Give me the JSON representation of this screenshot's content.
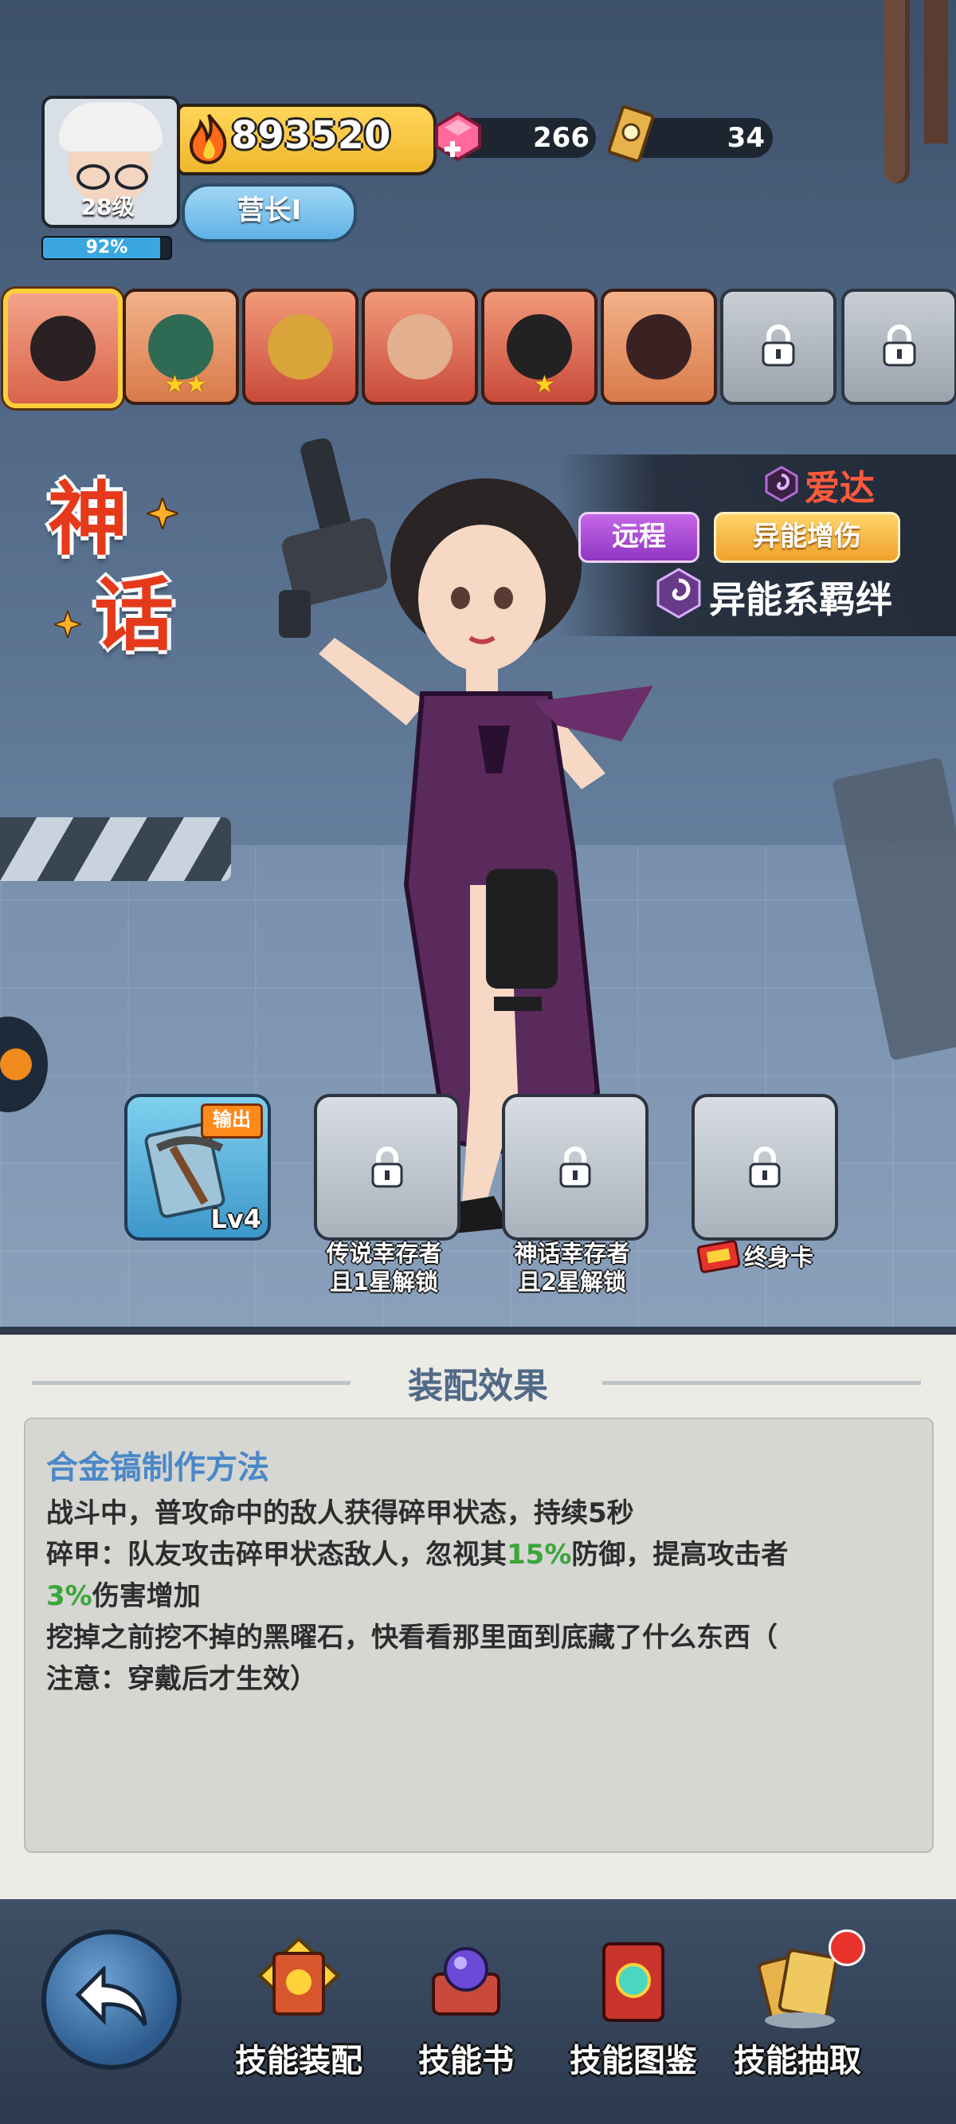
{
  "player": {
    "level_label": "28级",
    "exp_percent": 92,
    "exp_label": "92%",
    "power": "893520",
    "rank": "营长Ⅰ"
  },
  "currency": {
    "gems": "266",
    "tickets": "34"
  },
  "roster": [
    {
      "name": "hero-ada",
      "selected": true,
      "stars": ""
    },
    {
      "name": "hero-green-hair",
      "selected": false,
      "stars": "★★"
    },
    {
      "name": "hero-golden-monk",
      "selected": false,
      "stars": ""
    },
    {
      "name": "hero-sunglasses-man",
      "selected": false,
      "stars": ""
    },
    {
      "name": "hero-twin-tails",
      "selected": false,
      "stars": "★"
    },
    {
      "name": "hero-bun-girl",
      "selected": false,
      "stars": ""
    },
    {
      "name": "locked-slot",
      "locked": true
    },
    {
      "name": "locked-slot",
      "locked": true
    }
  ],
  "hero": {
    "rarity_1": "神",
    "rarity_2": "话",
    "name": "爱达",
    "tag_range": "远程",
    "tag_damage": "异能增伤",
    "bond": "异能系羁绊"
  },
  "equipment": {
    "slot1": {
      "badge": "输出",
      "level": "Lv4"
    },
    "slot2_unlock_line1": "传说幸存者",
    "slot2_unlock_line2": "且1星解锁",
    "slot3_unlock_line1": "神话幸存者",
    "slot3_unlock_line2": "且2星解锁",
    "slot4_unlock": "终身卡"
  },
  "effect_panel": {
    "title": "装配效果",
    "skill_name": "合金镐制作方法",
    "line1": "战斗中，普攻命中的敌人获得碎甲状态，持续5秒",
    "line2_a": "碎甲：队友攻击碎甲状态敌人，忽视其",
    "line2_hl": "15%",
    "line2_b": "防御，提高攻击者",
    "line3_hl": "3%",
    "line3_b": "伤害增加",
    "line4": "挖掉之前挖不掉的黑曜石，快看看那里面到底藏了什么东西（",
    "line5": "注意：穿戴后才生效）"
  },
  "nav": {
    "equip": "技能装配",
    "book": "技能书",
    "codex": "技能图鉴",
    "draw": "技能抽取"
  },
  "colors": {
    "accent_gold": "#ffcf3a",
    "highlight_green": "#3aa63a",
    "skill_title_blue": "#4b88c7",
    "hero_name_red": "#ff5a3c"
  }
}
